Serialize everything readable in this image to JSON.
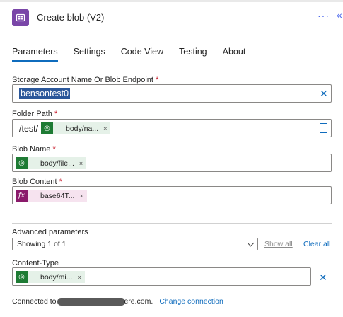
{
  "header": {
    "title": "Create blob (V2)",
    "more_label": "···",
    "collapse_label": "«"
  },
  "tabs": [
    {
      "label": "Parameters",
      "active": true
    },
    {
      "label": "Settings",
      "active": false
    },
    {
      "label": "Code View",
      "active": false
    },
    {
      "label": "Testing",
      "active": false
    },
    {
      "label": "About",
      "active": false
    }
  ],
  "fields": {
    "storage_account": {
      "label": "Storage Account Name Or Blob Endpoint",
      "required_mark": "*",
      "value": "bensontest0"
    },
    "folder_path": {
      "label": "Folder Path",
      "required_mark": "*",
      "prefix": "/test/",
      "token": {
        "text": "body/na...",
        "kind": "dynamic"
      }
    },
    "blob_name": {
      "label": "Blob Name",
      "required_mark": "*",
      "token": {
        "text": "body/file...",
        "kind": "dynamic"
      }
    },
    "blob_content": {
      "label": "Blob Content",
      "required_mark": "*",
      "token": {
        "text": "base64T...",
        "kind": "expression",
        "icon_text": "fx"
      }
    }
  },
  "advanced": {
    "label": "Advanced parameters",
    "dropdown_value": "Showing 1 of 1",
    "show_all": "Show all",
    "clear_all": "Clear all"
  },
  "content_type": {
    "label": "Content-Type",
    "token": {
      "text": "body/mi...",
      "kind": "dynamic"
    }
  },
  "connection": {
    "prefix": "Connected to",
    "suffix": "ere.com.",
    "change_label": "Change connection"
  },
  "token_remove_glyph": "×",
  "clear_glyph": "✕",
  "colors": {
    "accent": "#0f6cbd",
    "app_icon": "#7a46a8",
    "dynamic_token_bg": "#e5f1e8",
    "dynamic_token_icon": "#1e7b34",
    "expression_token_bg": "#f6e3ef",
    "expression_token_icon": "#8a1a6b",
    "selection": "#2b579a",
    "required": "#c50f1f"
  }
}
